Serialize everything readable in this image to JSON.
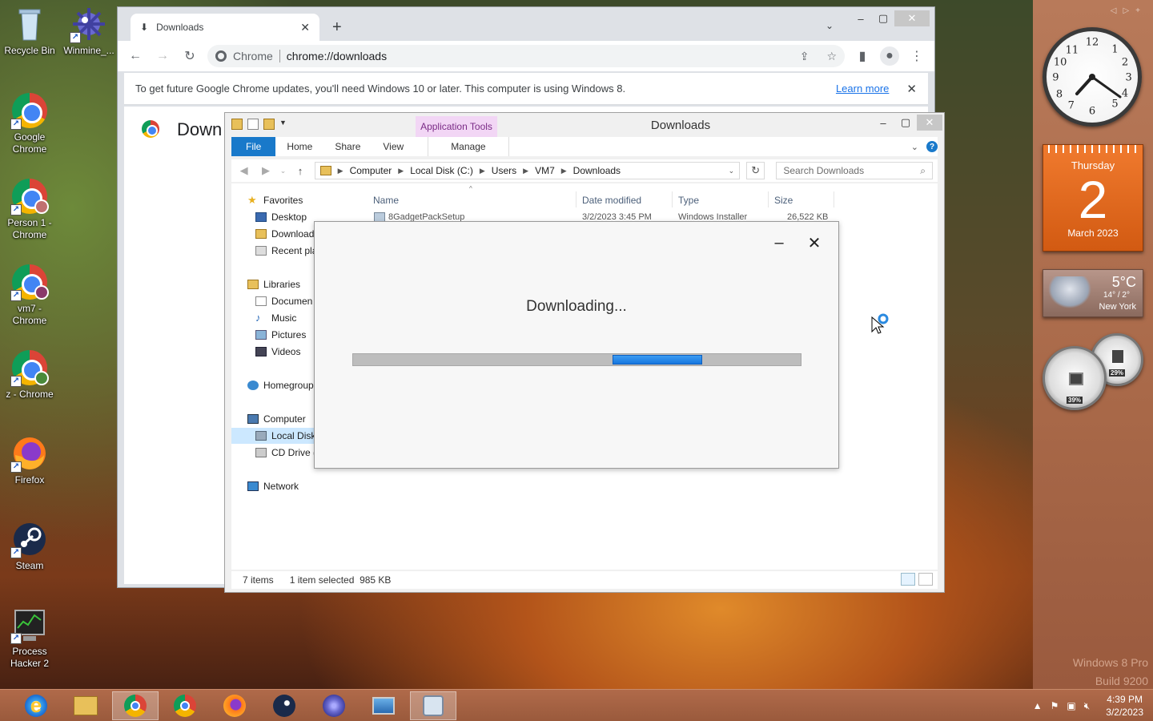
{
  "desktop": {
    "icons": [
      {
        "label": "Recycle Bin"
      },
      {
        "label": "Winmine_..."
      },
      {
        "label": "Google Chrome"
      },
      {
        "label": "Person 1 - Chrome"
      },
      {
        "label": "vm7 - Chrome"
      },
      {
        "label": "z - Chrome"
      },
      {
        "label": "Firefox"
      },
      {
        "label": "Steam"
      },
      {
        "label": "Process Hacker 2"
      }
    ]
  },
  "chrome": {
    "tab_title": "Downloads",
    "omnibox_prefix": "Chrome",
    "url": "chrome://downloads",
    "infobar_message": "To get future Google Chrome updates, you'll need Windows 10 or later. This computer is using Windows 8.",
    "infobar_link": "Learn more",
    "page_title": "Down"
  },
  "explorer": {
    "title": "Downloads",
    "context_tab": "Application Tools",
    "ribbon_tabs": {
      "file": "File",
      "home": "Home",
      "share": "Share",
      "view": "View",
      "manage": "Manage"
    },
    "breadcrumb": [
      "Computer",
      "Local Disk (C:)",
      "Users",
      "VM7",
      "Downloads"
    ],
    "search_placeholder": "Search Downloads",
    "nav": {
      "favorites": "Favorites",
      "desktop": "Desktop",
      "downloads": "Download",
      "recent": "Recent pla",
      "libraries": "Libraries",
      "documents": "Documen",
      "music": "Music",
      "pictures": "Pictures",
      "videos": "Videos",
      "homegroup": "Homegroup",
      "computer": "Computer",
      "local_disk": "Local Disk",
      "cd_drive": "CD Drive (",
      "network": "Network"
    },
    "columns": {
      "name": "Name",
      "date": "Date modified",
      "type": "Type",
      "size": "Size"
    },
    "first_file": {
      "name": "8GadgetPackSetup",
      "date": "3/2/2023 3:45 PM",
      "type": "Windows Installer",
      "size": "26,522 KB"
    },
    "status": {
      "count": "7 items",
      "selection": "1 item selected  985 KB"
    }
  },
  "dialog": {
    "message": "Downloading...",
    "progress_chunk_start": 0.58,
    "progress_chunk_end": 0.78
  },
  "gadgets": {
    "calendar": {
      "weekday": "Thursday",
      "day": "2",
      "month_year": "March 2023"
    },
    "weather": {
      "temp": "5°C",
      "range": "14° / 2°",
      "city": "New York"
    },
    "meters": {
      "cpu": "39%",
      "ram": "29%"
    },
    "watermark": {
      "line1": "Windows 8 Pro",
      "line2": "Build 9200"
    }
  },
  "taskbar": {
    "time": "4:39 PM",
    "date": "3/2/2023"
  },
  "colors": {
    "accent": "#1979ca",
    "progress": "#1677e0",
    "calendar": "#e8661e"
  }
}
